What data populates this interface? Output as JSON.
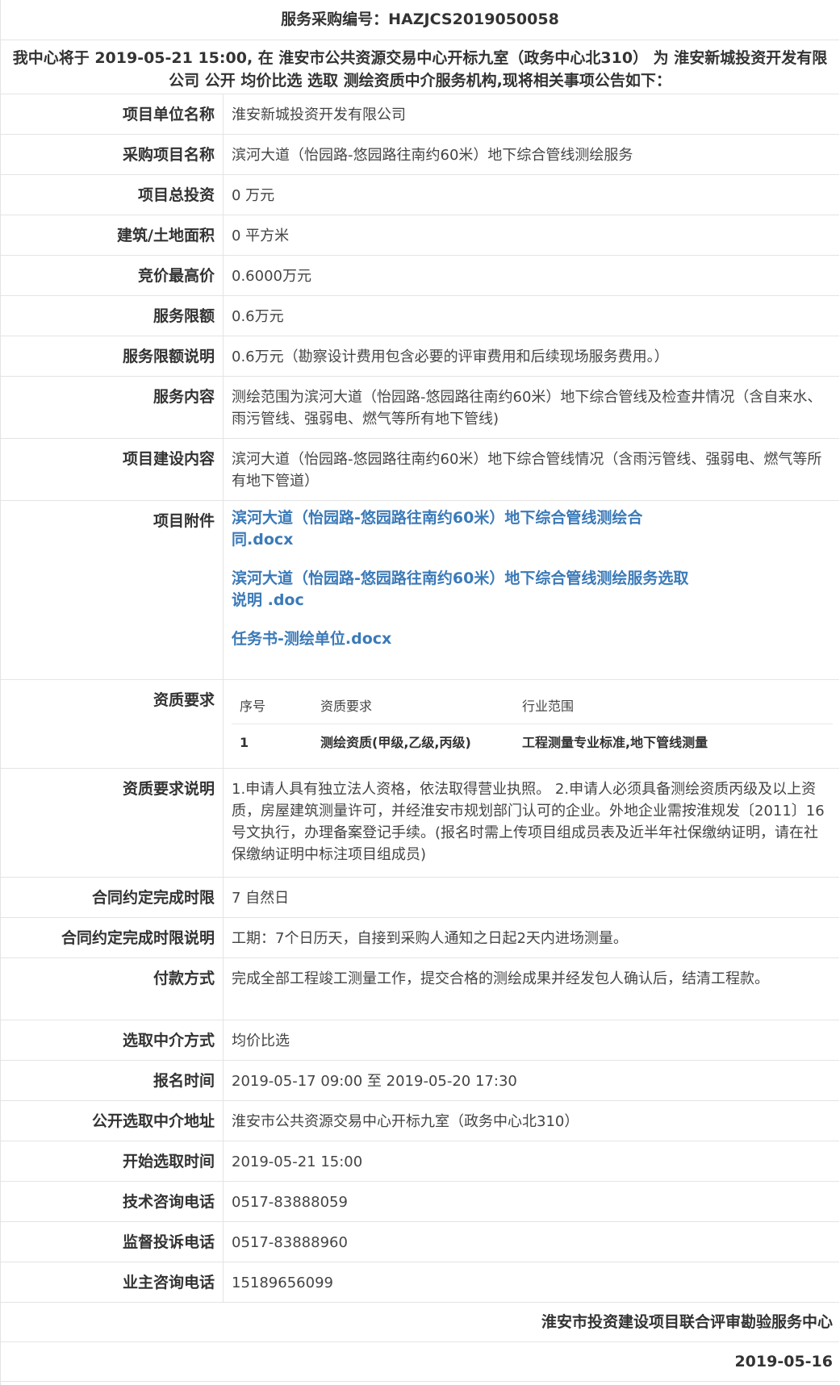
{
  "header": {
    "code_line": "服务采购编号：HAZJCS2019050058",
    "intro": "我中心将于 2019-05-21 15:00, 在 淮安市公共资源交易中心开标九室（政务中心北310） 为 淮安新城投资开发有限公司 公开 均价比选 选取 测绘资质中介服务机构,现将相关事项公告如下："
  },
  "rows": {
    "unit": {
      "label": "项目单位名称",
      "value": "淮安新城投资开发有限公司"
    },
    "project_name": {
      "label": "采购项目名称",
      "value": "滨河大道（怡园路-悠园路往南约60米）地下综合管线测绘服务"
    },
    "investment": {
      "label": "项目总投资",
      "value": "0 万元"
    },
    "area": {
      "label": "建筑/土地面积",
      "value": "0 平方米"
    },
    "max_price": {
      "label": "竞价最高价",
      "value": "0.6000万元"
    },
    "service_limit": {
      "label": "服务限额",
      "value": "0.6万元"
    },
    "limit_desc": {
      "label": "服务限额说明",
      "value": "0.6万元（勘察设计费用包含必要的评审费用和后续现场服务费用。）"
    },
    "service_content": {
      "label": "服务内容",
      "value": "测绘范围为滨河大道（怡园路-悠园路往南约60米）地下综合管线及检查井情况（含自来水、雨污管线、强弱电、燃气等所有地下管线)"
    },
    "build_content": {
      "label": "项目建设内容",
      "value": "滨河大道（怡园路-悠园路往南约60米）地下综合管线情况（含雨污管线、强弱电、燃气等所有地下管道）"
    },
    "attachments": {
      "label": "项目附件",
      "files": [
        "滨河大道（怡园路-悠园路往南约60米）地下综合管线测绘合同.docx",
        "滨河大道（怡园路-悠园路往南约60米）地下综合管线测绘服务选取说明 .doc",
        "任务书-测绘单位.docx"
      ]
    },
    "qualification": {
      "label": "资质要求",
      "headers": [
        "序号",
        "资质要求",
        "行业范围"
      ],
      "rows": [
        [
          "1",
          "测绘资质(甲级,乙级,丙级)",
          "工程测量专业标准,地下管线测量"
        ]
      ]
    },
    "qual_desc": {
      "label": "资质要求说明",
      "value": "1.申请人具有独立法人资格，依法取得营业执照。 2.申请人必须具备测绘资质丙级及以上资质，房屋建筑测量许可，并经淮安市规划部门认可的企业。外地企业需按淮规发〔2011〕16号文执行，办理备案登记手续。(报名时需上传项目组成员表及近半年社保缴纳证明，请在社保缴纳证明中标注项目组成员)"
    },
    "deadline": {
      "label": "合同约定完成时限",
      "value": "7 自然日"
    },
    "deadline_desc": {
      "label": "合同约定完成时限说明",
      "value": "工期：7个日历天，自接到采购人通知之日起2天内进场测量。"
    },
    "payment": {
      "label": "付款方式",
      "value": "完成全部工程竣工测量工作，提交合格的测绘成果并经发包人确认后，结清工程款。"
    },
    "method": {
      "label": "选取中介方式",
      "value": "均价比选"
    },
    "register_time": {
      "label": "报名时间",
      "value": "2019-05-17 09:00 至 2019-05-20 17:30"
    },
    "address": {
      "label": "公开选取中介地址",
      "value": "淮安市公共资源交易中心开标九室（政务中心北310）"
    },
    "start_time": {
      "label": "开始选取时间",
      "value": "2019-05-21 15:00"
    },
    "tech_phone": {
      "label": "技术咨询电话",
      "value": "0517-83888059"
    },
    "complaint_phone": {
      "label": "监督投诉电话",
      "value": "0517-83888960"
    },
    "owner_phone": {
      "label": "业主咨询电话",
      "value": "15189656099"
    }
  },
  "footer": {
    "org": "淮安市投资建设项目联合评审勘验服务中心",
    "date": "2019-05-16"
  },
  "colors": {
    "link": "#3b7ab8",
    "border": "#e4e4e4",
    "text": "#333333"
  }
}
